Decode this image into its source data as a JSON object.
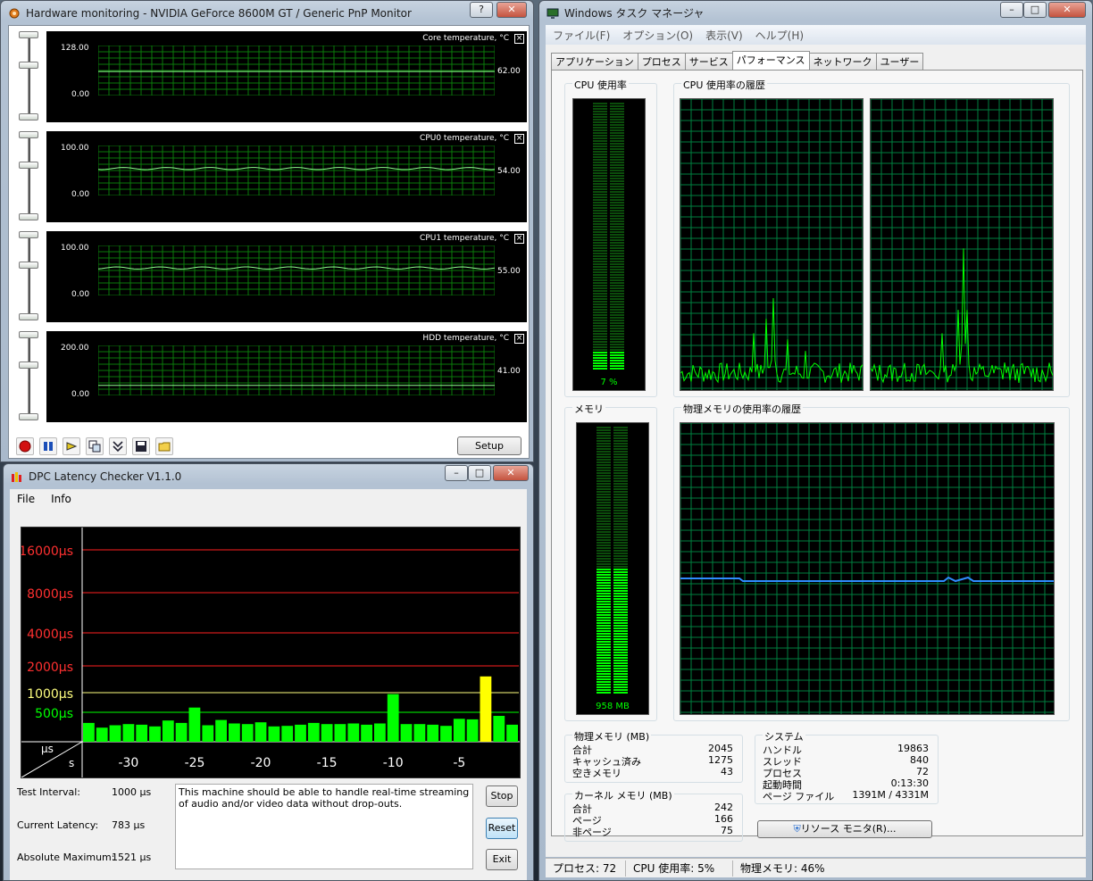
{
  "hw": {
    "title": "Hardware monitoring - NVIDIA GeForce 8600M GT / Generic PnP Monitor",
    "help_label": "?",
    "close_label": "✕",
    "panes": [
      {
        "name": "Core temperature, °C",
        "max": "128.00",
        "min": "0.00",
        "value": "62.00"
      },
      {
        "name": "CPU0 temperature, °C",
        "max": "100.00",
        "min": "0.00",
        "value": "54.00"
      },
      {
        "name": "CPU1 temperature, °C",
        "max": "100.00",
        "min": "0.00",
        "value": "55.00"
      },
      {
        "name": "HDD temperature, °C",
        "max": "200.00",
        "min": "0.00",
        "value": "41.00"
      }
    ],
    "setup_label": "Setup",
    "pane_close_label": "×"
  },
  "dpc": {
    "title": "DPC Latency Checker V1.1.0",
    "menu": {
      "file": "File",
      "info": "Info"
    },
    "y_labels": [
      "16000µs",
      "8000µs",
      "4000µs",
      "2000µs",
      "1000µs",
      "500µs"
    ],
    "x_labels": [
      "-30",
      "-25",
      "-20",
      "-15",
      "-10",
      "-5"
    ],
    "corner_top": "µs",
    "corner_bottom": "s",
    "test_interval_label": "Test Interval:",
    "test_interval_value": "1000 µs",
    "current_latency_label": "Current Latency:",
    "current_latency_value": "783 µs",
    "abs_max_label": "Absolute Maximum:",
    "abs_max_value": "1521 µs",
    "message": "This machine should be able to handle real-time streaming of audio and/or video data without drop-outs.",
    "stop_label": "Stop",
    "reset_label": "Reset",
    "exit_label": "Exit"
  },
  "chart_data": {
    "type": "bar",
    "title": "",
    "xlabel": "s",
    "ylabel": "µs",
    "x": [
      -33,
      -32,
      -31,
      -30,
      -29,
      -28,
      -27,
      -26,
      -25,
      -24,
      -23,
      -22,
      -21,
      -20,
      -19,
      -18,
      -17,
      -16,
      -15,
      -14,
      -13,
      -12,
      -11,
      -10,
      -9,
      -8,
      -7,
      -6,
      -5,
      -4,
      -3,
      -2,
      -1
    ],
    "values": [
      320,
      240,
      280,
      300,
      290,
      260,
      360,
      320,
      590,
      280,
      370,
      310,
      300,
      330,
      260,
      270,
      290,
      320,
      300,
      300,
      310,
      290,
      310,
      950,
      300,
      300,
      290,
      270,
      390,
      380,
      1521,
      440,
      290
    ],
    "y_ticks": [
      500,
      1000,
      2000,
      4000,
      8000,
      16000
    ],
    "threshold_colors": {
      "ok": "#00ff00",
      "warn": "#ffff00",
      "bad": "#ff0000"
    }
  },
  "tm": {
    "title": "Windows タスク マネージャ",
    "menu": [
      "ファイル(F)",
      "オプション(O)",
      "表示(V)",
      "ヘルプ(H)"
    ],
    "tabs": [
      "アプリケーション",
      "プロセス",
      "サービス",
      "パフォーマンス",
      "ネットワーク",
      "ユーザー"
    ],
    "cpu_usage_title": "CPU 使用率",
    "cpu_usage_value": "7 %",
    "cpu_history_title": "CPU 使用率の履歴",
    "mem_title": "メモリ",
    "mem_value": "958 MB",
    "mem_history_title": "物理メモリの使用率の履歴",
    "phys_mem": {
      "title": "物理メモリ (MB)",
      "rows": [
        [
          "合計",
          "2045"
        ],
        [
          "キャッシュ済み",
          "1275"
        ],
        [
          "空きメモリ",
          "43"
        ]
      ]
    },
    "kernel_mem": {
      "title": "カーネル メモリ (MB)",
      "rows": [
        [
          "合計",
          "242"
        ],
        [
          "ページ",
          "166"
        ],
        [
          "非ページ",
          "75"
        ]
      ]
    },
    "system": {
      "title": "システム",
      "rows": [
        [
          "ハンドル",
          "19863"
        ],
        [
          "スレッド",
          "840"
        ],
        [
          "プロセス",
          "72"
        ],
        [
          "起動時間",
          "0:13:30"
        ],
        [
          "ページ ファイル",
          "1391M / 4331M"
        ]
      ]
    },
    "resource_monitor_label": "リソース モニタ(R)...",
    "status": {
      "processes": "プロセス: 72",
      "cpu": "CPU 使用率: 5%",
      "memory": "物理メモリ: 46%"
    }
  }
}
